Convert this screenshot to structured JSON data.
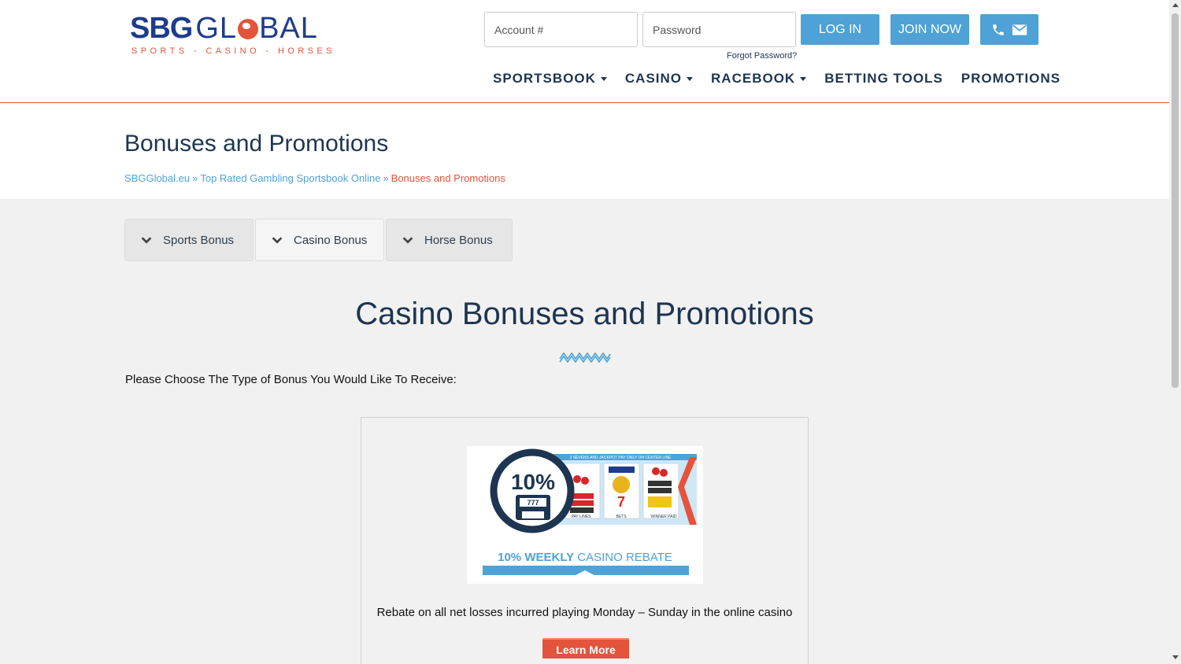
{
  "header": {
    "logo": {
      "main_left": "SBG",
      "main_mid": "GL",
      "main_right": "BAL",
      "tagline": "SPORTS - CASINO - HORSES"
    },
    "account_placeholder": "Account #",
    "password_placeholder": "Password",
    "login_label": "LOG IN",
    "join_label": "JOIN NOW",
    "forgot_label": "Forgot Password?",
    "contact_icons": [
      "phone-icon",
      "envelope-icon"
    ]
  },
  "nav": {
    "items": [
      {
        "label": "SPORTSBOOK",
        "dropdown": true
      },
      {
        "label": "CASINO",
        "dropdown": true
      },
      {
        "label": "RACEBOOK",
        "dropdown": true
      },
      {
        "label": "BETTING TOOLS",
        "dropdown": false
      },
      {
        "label": "PROMOTIONS",
        "dropdown": false
      }
    ]
  },
  "page": {
    "title": "Bonuses and Promotions",
    "breadcrumb": {
      "links": [
        "SBGGlobal.eu",
        "Top Rated Gambling Sportsbook Online"
      ],
      "separator": "»",
      "current": "Bonuses and Promotions"
    }
  },
  "tabs": [
    {
      "label": "Sports Bonus",
      "active": false
    },
    {
      "label": "Casino Bonus",
      "active": true
    },
    {
      "label": "Horse Bonus",
      "active": false
    }
  ],
  "section": {
    "title": "Casino Bonuses and Promotions",
    "prompt": "Please Choose The Type of Bonus You Would Like To Receive:"
  },
  "promo": {
    "image_badge": "10%",
    "image_caption_bold": "10% WEEKLY",
    "image_caption": "CASINO REBATE",
    "image_banner": "3 SEVENS AND JACKPOT PAY ONLY ON CENTER LINE",
    "reel_labels": [
      "PAY LINES",
      "BETS",
      "WINNER PAID"
    ],
    "description": "Rebate on all net losses incurred playing Monday – Sunday in the online casino",
    "button_label": "Learn More"
  },
  "colors": {
    "brand_navy": "#1e3c8c",
    "accent_orange": "#e4533b",
    "button_blue": "#4ea2d5",
    "text_dark": "#1d3550"
  }
}
